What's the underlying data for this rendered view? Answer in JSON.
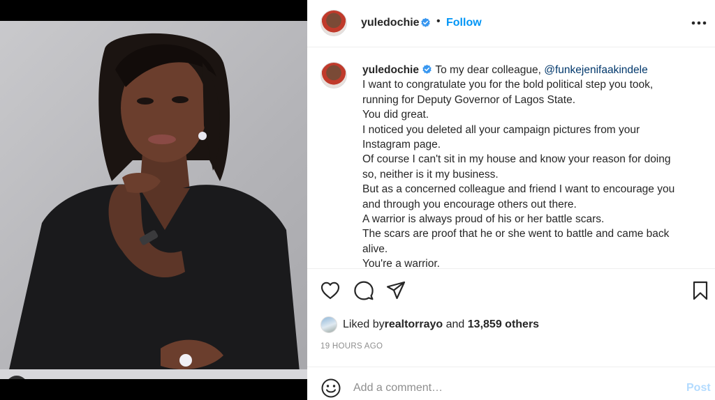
{
  "post": {
    "photo_alt": "Portrait photo",
    "username": "yuledochie",
    "follow_label": "Follow",
    "separator": "•"
  },
  "caption": {
    "username": "yuledochie",
    "intro": "To my dear colleague, ",
    "mention": "@funkejenifaakindele",
    "lines": [
      "I want to congratulate you for the bold political step you took,",
      "running for Deputy Governor of Lagos State.",
      "You did great.",
      "I noticed you deleted all your campaign pictures from your",
      "Instagram page.",
      "Of course I can't sit in my house and know your reason for doing",
      "so, neither is it my business.",
      "But as a concerned colleague and friend I want to encourage you",
      "and through you encourage others out there.",
      "A warrior is always proud of his or her battle scars.",
      "The scars are proof that he or she went to battle and came back",
      "alive.",
      "You're a warrior."
    ]
  },
  "likes": {
    "prefix": "Liked by ",
    "user": "realtorrayo",
    "middle": " and ",
    "count": "13,859 others"
  },
  "timestamp": "19 HOURS AGO",
  "comment": {
    "placeholder": "Add a comment…",
    "post_label": "Post"
  },
  "icons": {
    "verified": "verified-badge-icon",
    "more": "more-options-icon",
    "like": "heart-icon",
    "comment": "comment-icon",
    "share": "share-icon",
    "save": "bookmark-icon",
    "emoji": "emoji-icon",
    "tag": "user-tag-icon"
  },
  "colors": {
    "accent": "#0095f6",
    "post_disabled": "#b3dbff",
    "mention": "#00376b"
  }
}
